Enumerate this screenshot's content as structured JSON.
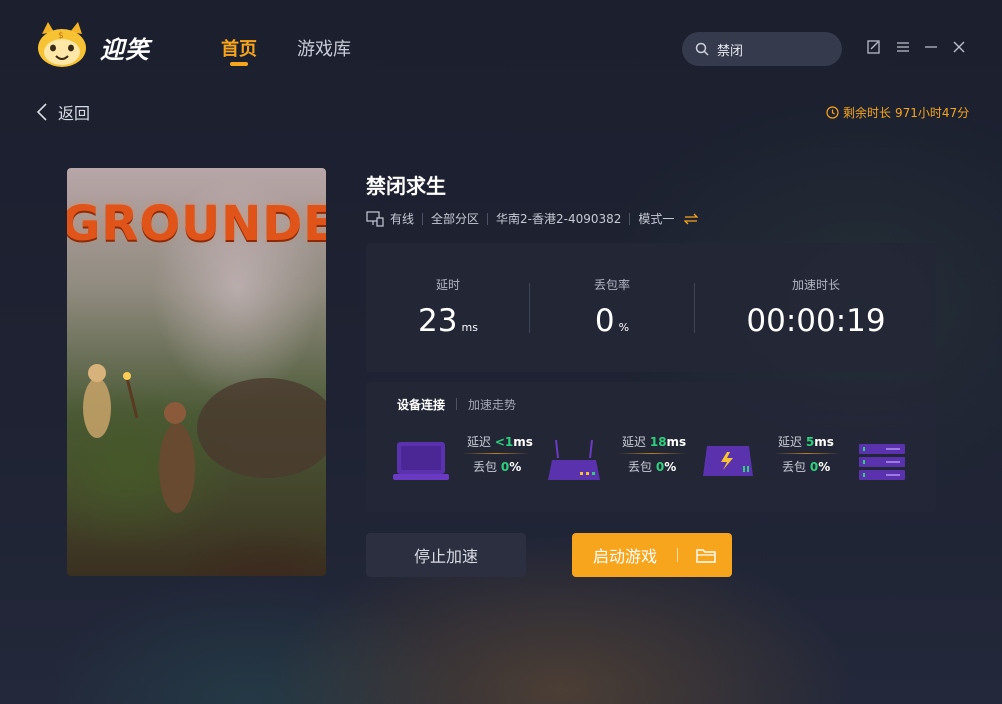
{
  "app": {
    "logo_text": "迎笑",
    "nav": {
      "home": "首页",
      "library": "游戏库"
    },
    "search": {
      "value": "禁闭",
      "placeholder": ""
    }
  },
  "header": {
    "back_label": "返回",
    "remaining_label": "剩余时长",
    "remaining_value": "971小时47分"
  },
  "game": {
    "title": "禁闭求生",
    "cover_text": "GROUNDED",
    "connection": "有线",
    "region": "全部分区",
    "server": "华南2-香港2-4090382",
    "mode": "模式一"
  },
  "stats": {
    "latency": {
      "label": "延时",
      "value": "23",
      "unit": "ms"
    },
    "packet_loss": {
      "label": "丢包率",
      "value": "0",
      "unit": "%"
    },
    "duration": {
      "label": "加速时长",
      "value": "00:00:19"
    }
  },
  "devices": {
    "tabs": {
      "connection": "设备连接",
      "trend": "加速走势"
    },
    "links": [
      {
        "latency_label": "延迟",
        "latency_value": "<1",
        "latency_unit": "ms",
        "loss_label": "丢包",
        "loss_value": "0",
        "loss_unit": "%"
      },
      {
        "latency_label": "延迟",
        "latency_value": "18",
        "latency_unit": "ms",
        "loss_label": "丢包",
        "loss_value": "0",
        "loss_unit": "%"
      },
      {
        "latency_label": "延迟",
        "latency_value": "5",
        "latency_unit": "ms",
        "loss_label": "丢包",
        "loss_value": "0",
        "loss_unit": "%"
      }
    ]
  },
  "actions": {
    "stop": "停止加速",
    "start": "启动游戏"
  },
  "colors": {
    "accent": "#f7a51c",
    "good": "#2ed07e",
    "device": "#6a3bc2"
  },
  "icons": [
    "mascot-logo-icon",
    "search-icon",
    "feedback-icon",
    "menu-icon",
    "minimize-icon",
    "close-icon",
    "chevron-left-icon",
    "clock-icon",
    "wired-network-icon",
    "swap-icon",
    "laptop-icon",
    "router-icon",
    "accelerator-box-icon",
    "server-rack-icon",
    "folder-icon"
  ]
}
